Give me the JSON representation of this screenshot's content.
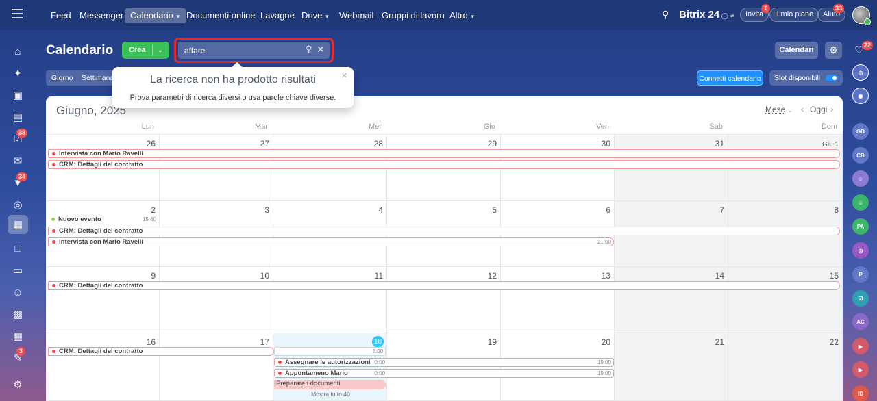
{
  "topbar": {
    "nav": [
      "Feed",
      "Messenger",
      "Calendario",
      "Documenti online",
      "Lavagne",
      "Drive",
      "Webmail",
      "Gruppi di lavoro",
      "Altro"
    ],
    "brand": "Bitrix",
    "brand_num": "24",
    "invite": "Invita",
    "invite_badge": "1",
    "plan": "Il mio piano",
    "help": "Aiuto",
    "help_badge": "33"
  },
  "sidebar": {
    "tasks_badge": "38",
    "feed_badge": "34",
    "edit_badge": "3"
  },
  "right_sidebar": {
    "bell_badge": "22",
    "avatars": [
      "GD",
      "CB",
      "PA",
      "P",
      "AC",
      "ID"
    ]
  },
  "header": {
    "title": "Calendario",
    "create": "Crea",
    "search_value": "affare",
    "calendars_btn": "Calendari",
    "view_tabs": [
      "Giorno",
      "Settimana"
    ],
    "connect": "Connetti calendario",
    "slots": "Slot disponibili"
  },
  "tooltip": {
    "title": "La ricerca non ha prodotto risultati",
    "text": "Prova parametri di ricerca diversi o usa parole chiave diverse."
  },
  "calendar": {
    "month": "Giugno, 2025",
    "view": "Mese",
    "today": "Oggi",
    "days": [
      "Lun",
      "Mar",
      "Mer",
      "Gio",
      "Ven",
      "Sab",
      "Dom"
    ],
    "weeks": [
      [
        "26",
        "27",
        "28",
        "29",
        "30",
        "31",
        "Giu 1"
      ],
      [
        "2",
        "3",
        "4",
        "5",
        "6",
        "7",
        "8"
      ],
      [
        "9",
        "10",
        "11",
        "12",
        "13",
        "14",
        "15"
      ],
      [
        "16",
        "17",
        "18",
        "19",
        "20",
        "21",
        "22"
      ]
    ],
    "events": {
      "intervista": "Intervista con Mario Ravelli",
      "crm": "CRM: Dettagli del contratto",
      "nuovo": "Nuovo evento",
      "nuovo_time": "15:40",
      "interv_time": "21:00",
      "today_time": "2:00",
      "assegnare": "Assegnare le autorizzazioni",
      "assegnare_t1": "0:00",
      "assegnare_t2": "19:00",
      "appunt": "Appuntameno Mario",
      "appunt_t1": "0:00",
      "appunt_t2": "19:00",
      "preparare": "Preparare i documenti",
      "more": "Mostra tutto 40"
    }
  },
  "colors": {
    "accent": "#2fc6f6",
    "green": "#3bc058",
    "red": "#e8474a",
    "navy": "#1f3878"
  }
}
